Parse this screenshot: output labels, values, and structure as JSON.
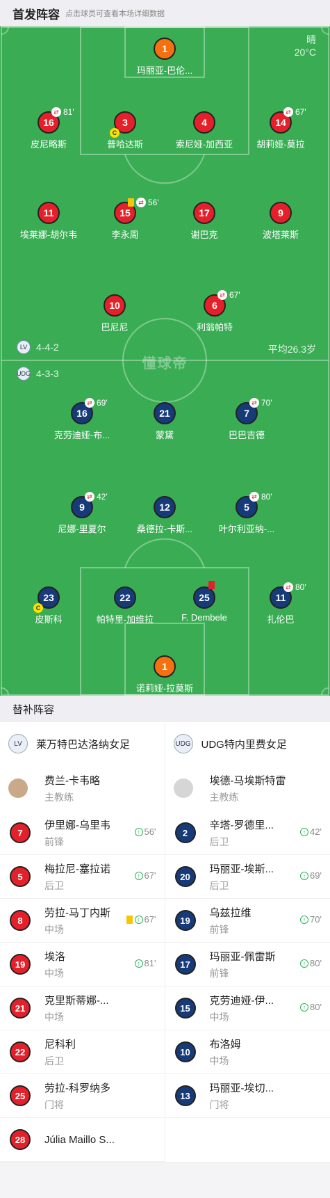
{
  "header": {
    "title": "首发阵容",
    "subtitle": "点击球员可查看本场详细数据"
  },
  "weather": {
    "condition": "晴",
    "temp": "20°C"
  },
  "watermark": "懂球帝",
  "home": {
    "formation": "4-4-2",
    "badge": "LV"
  },
  "away": {
    "formation": "4-3-3",
    "badge": "UDG"
  },
  "avg_age": "平均26.3岁",
  "home_players": [
    {
      "num": "1",
      "name": "玛丽亚-巴伦...",
      "color": "orange"
    },
    {
      "num": "16",
      "name": "皮尼略斯",
      "sub": "81'"
    },
    {
      "num": "3",
      "name": "普哈达斯",
      "captain": "C"
    },
    {
      "num": "4",
      "name": "索尼娅-加西亚"
    },
    {
      "num": "14",
      "name": "胡莉娅-莫拉",
      "sub": "67'"
    },
    {
      "num": "11",
      "name": "埃莱娜-胡尔韦"
    },
    {
      "num": "15",
      "name": "李永周",
      "sub": "56'"
    },
    {
      "num": "17",
      "name": "谢巴克"
    },
    {
      "num": "9",
      "name": "波塔莱斯"
    },
    {
      "num": "10",
      "name": "巴尼尼"
    },
    {
      "num": "6",
      "name": "利翁帕特",
      "sub": "67'"
    }
  ],
  "away_players": [
    {
      "num": "16",
      "name": "克劳迪娅-布...",
      "sub": "69'"
    },
    {
      "num": "21",
      "name": "蒙黛"
    },
    {
      "num": "7",
      "name": "巴巴吉德",
      "sub": "70'"
    },
    {
      "num": "9",
      "name": "尼娜-里夏尔",
      "sub": "42'"
    },
    {
      "num": "12",
      "name": "桑德拉-卡斯..."
    },
    {
      "num": "5",
      "name": "叶尔利亚纳-...",
      "sub": "80'"
    },
    {
      "num": "23",
      "name": "皮斯科",
      "captain": "C"
    },
    {
      "num": "22",
      "name": "帕特里-加维拉"
    },
    {
      "num": "25",
      "name": "F. Dembele"
    },
    {
      "num": "11",
      "name": "扎伦巴",
      "sub": "80'"
    },
    {
      "num": "1",
      "name": "诺莉娅-拉莫斯",
      "color": "orange"
    }
  ],
  "bench": {
    "title": "替补阵容",
    "home_team": "莱万特巴达洛纳女足",
    "away_team": "UDG特内里费女足",
    "home_coach": {
      "name": "费兰-卡韦略",
      "role": "主教练"
    },
    "away_coach": {
      "name": "埃德-马埃斯特雷",
      "role": "主教练"
    },
    "home_subs": [
      {
        "num": "7",
        "name": "伊里娜-乌里韦",
        "pos": "前锋",
        "min": "56'"
      },
      {
        "num": "5",
        "name": "梅拉尼-塞拉诺",
        "pos": "后卫",
        "min": "67'"
      },
      {
        "num": "8",
        "name": "劳拉-马丁内斯",
        "pos": "中场",
        "min": "67'"
      },
      {
        "num": "19",
        "name": "埃洛",
        "pos": "中场",
        "min": "81'"
      },
      {
        "num": "21",
        "name": "克里斯蒂娜-...",
        "pos": "中场",
        "min": ""
      },
      {
        "num": "22",
        "name": "尼科利",
        "pos": "后卫",
        "min": ""
      },
      {
        "num": "25",
        "name": "劳拉-科罗纳多",
        "pos": "门将",
        "min": ""
      },
      {
        "num": "28",
        "name": "Júlia Maillo S...",
        "pos": "",
        "min": ""
      }
    ],
    "away_subs": [
      {
        "num": "2",
        "name": "辛塔-罗德里...",
        "pos": "后卫",
        "min": "42'"
      },
      {
        "num": "20",
        "name": "玛丽亚-埃斯...",
        "pos": "后卫",
        "min": "69'"
      },
      {
        "num": "19",
        "name": "乌兹拉维",
        "pos": "前锋",
        "min": "70'"
      },
      {
        "num": "17",
        "name": "玛丽亚-佩雷斯",
        "pos": "前锋",
        "min": "80'"
      },
      {
        "num": "15",
        "name": "克劳迪娅-伊...",
        "pos": "中场",
        "min": "80'"
      },
      {
        "num": "10",
        "name": "布洛姆",
        "pos": "中场",
        "min": ""
      },
      {
        "num": "13",
        "name": "玛丽亚-埃切...",
        "pos": "门将",
        "min": ""
      }
    ]
  }
}
